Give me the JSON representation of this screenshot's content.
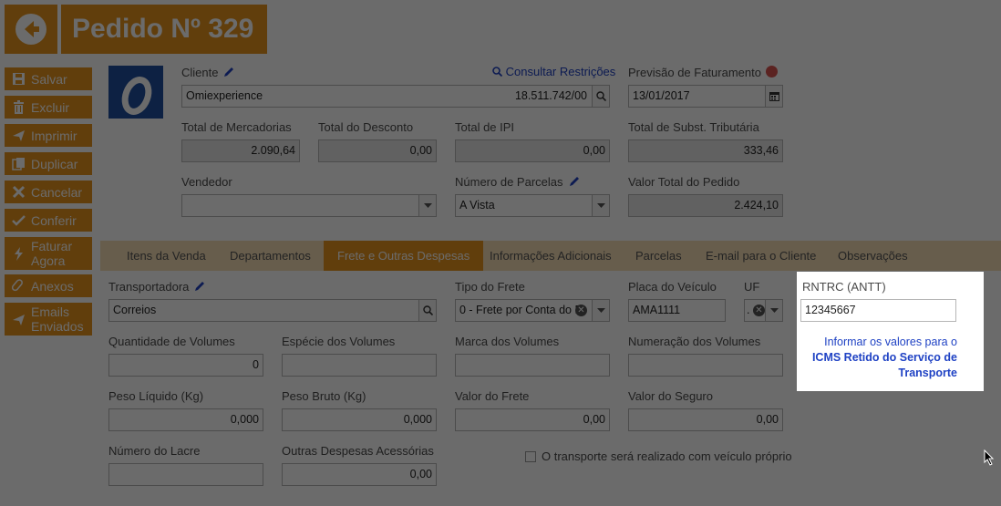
{
  "header": {
    "title": "Pedido Nº 329"
  },
  "sidebar": {
    "items": [
      {
        "label": "Salvar",
        "icon": "save-icon"
      },
      {
        "label": "Excluir",
        "icon": "trash-icon"
      },
      {
        "label": "Imprimir",
        "icon": "print-icon"
      },
      {
        "label": "Duplicar",
        "icon": "duplicate-icon"
      },
      {
        "label": "Cancelar",
        "icon": "close-icon"
      },
      {
        "label": "Conferir",
        "icon": "check-icon"
      },
      {
        "label": "Faturar",
        "label2": "Agora",
        "icon": "bolt-icon"
      },
      {
        "label": "Anexos",
        "icon": "paperclip-icon"
      },
      {
        "label": "Emails",
        "label2": "Enviados",
        "icon": "send-icon"
      }
    ]
  },
  "cliente": {
    "label": "Cliente",
    "value": "Omiexperience",
    "doc": "18.511.742/00",
    "restricoes": "Consultar Restrições"
  },
  "previsao": {
    "label": "Previsão de Faturamento",
    "value": "13/01/2017"
  },
  "totais": {
    "mercadorias_label": "Total de Mercadorias",
    "mercadorias": "2.090,64",
    "desconto_label": "Total do Desconto",
    "desconto": "0,00",
    "ipi_label": "Total de IPI",
    "ipi": "0,00",
    "subst_label": "Total de Subst. Tributária",
    "subst": "333,46"
  },
  "vendedor": {
    "label": "Vendedor",
    "value": ""
  },
  "parcelas": {
    "label": "Número de Parcelas",
    "value": "A Vista"
  },
  "valor_total": {
    "label": "Valor Total do Pedido",
    "value": "2.424,10"
  },
  "tabs": [
    {
      "label": "Itens da Venda"
    },
    {
      "label": "Departamentos"
    },
    {
      "label": "Frete e Outras Despesas"
    },
    {
      "label": "Informações Adicionais"
    },
    {
      "label": "Parcelas"
    },
    {
      "label": "E-mail para o Cliente"
    },
    {
      "label": "Observações"
    }
  ],
  "frete": {
    "transportadora_label": "Transportadora",
    "transportadora": "Correios",
    "tipo_label": "Tipo do Frete",
    "tipo": "0 - Frete por Conta do E",
    "placa_label": "Placa do Veículo",
    "placa": "AMA1111",
    "uf_label": "UF",
    "uf": ".",
    "rntrc_label": "RNTRC (ANTT)",
    "rntrc": "12345667",
    "info_text": "Informar os valores para o",
    "info_link": "ICMS Retido do Serviço de Transporte",
    "qtd_label": "Quantidade de Volumes",
    "qtd": "0",
    "especie_label": "Espécie dos Volumes",
    "especie": "",
    "marca_label": "Marca dos Volumes",
    "marca": "",
    "numeracao_label": "Numeração dos Volumes",
    "numeracao": "",
    "peso_liq_label": "Peso Líquido (Kg)",
    "peso_liq": "0,000",
    "peso_bruto_label": "Peso Bruto (Kg)",
    "peso_bruto": "0,000",
    "valor_frete_label": "Valor do Frete",
    "valor_frete": "0,00",
    "valor_seguro_label": "Valor do Seguro",
    "valor_seguro": "0,00",
    "lacre_label": "Número do Lacre",
    "lacre": "",
    "outras_label": "Outras Despesas Acessórias",
    "outras": "0,00",
    "proprio_label": "O transporte será realizado com veículo próprio"
  },
  "colors": {
    "accent": "#e8951e",
    "logo_bg": "#1f4fa0",
    "link": "#1f42c4",
    "overlay": "rgba(0,0,0,0.58)"
  }
}
